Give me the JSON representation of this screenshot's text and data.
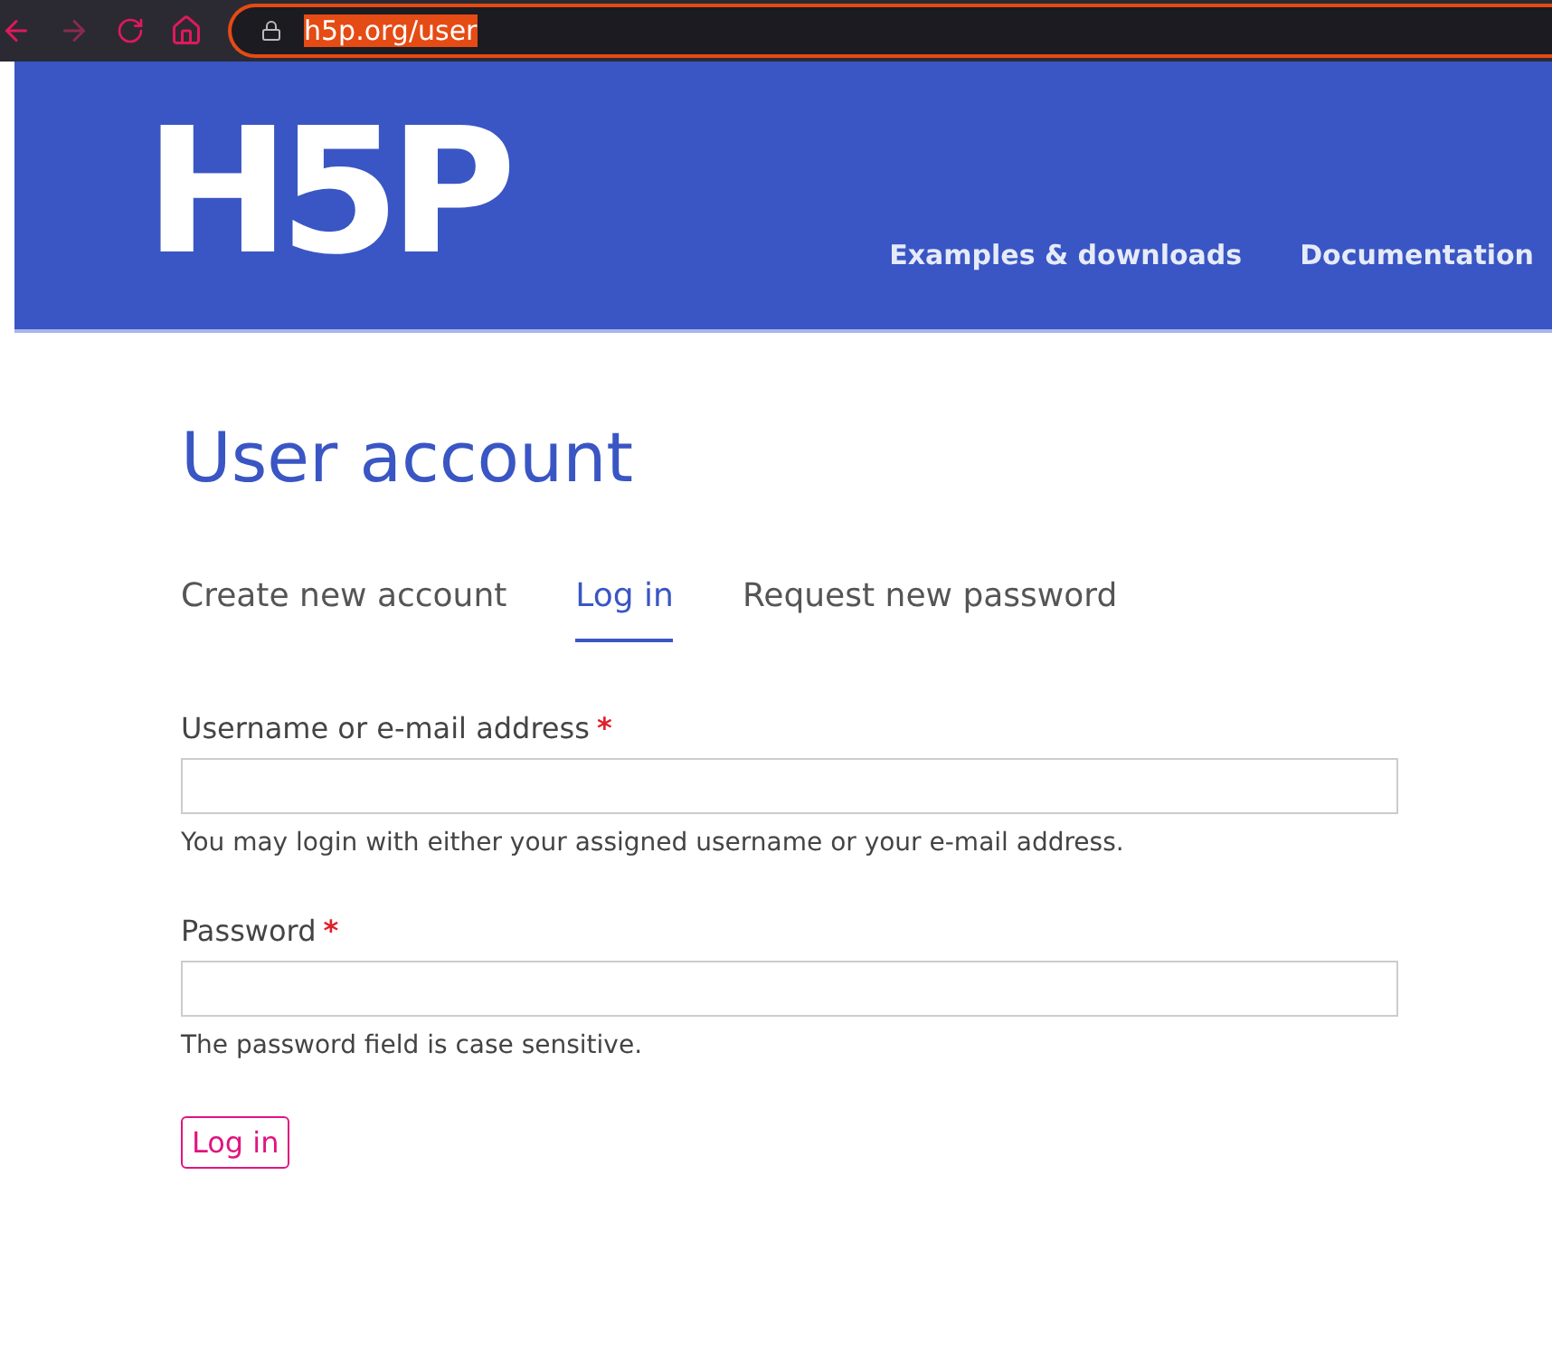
{
  "browser": {
    "url": "h5p.org/user"
  },
  "header": {
    "logo": "H5P",
    "nav": [
      "Examples & downloads",
      "Documentation"
    ]
  },
  "title": "User account",
  "tabs": [
    {
      "label": "Create new account",
      "selected": false
    },
    {
      "label": "Log in",
      "selected": true
    },
    {
      "label": "Request new password",
      "selected": false
    }
  ],
  "fields": [
    {
      "label": "Username or e-mail address",
      "required": "*",
      "help": "You may login with either your assigned username or your e-mail address."
    },
    {
      "label": "Password",
      "required": "*",
      "help": "The password field is case sensitive."
    }
  ],
  "submit": "Log in"
}
